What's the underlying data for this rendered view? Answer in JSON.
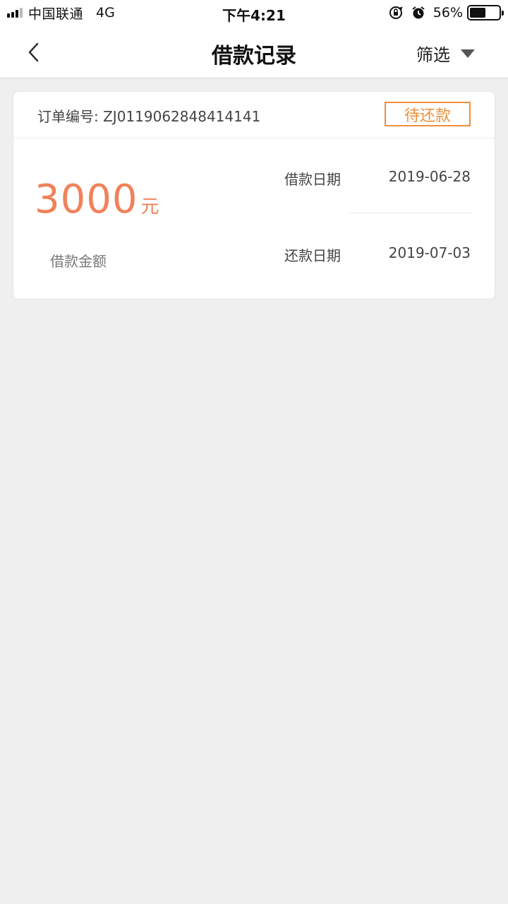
{
  "status_bar": {
    "carrier": "中国联通",
    "network": "4G",
    "time": "下午4:21",
    "battery": "56%",
    "battery_level": 0.56
  },
  "nav": {
    "title": "借款记录",
    "filter_label": "筛选",
    "icons": {
      "back": "chevron-left-icon",
      "filter_caret": "caret-down-icon"
    }
  },
  "record": {
    "order_label": "订单编号:",
    "order_number": "ZJ0119062848414141",
    "status": "待还款",
    "amount": "3000",
    "amount_unit": "元",
    "amount_label": "借款金额",
    "loan_date_label": "借款日期",
    "loan_date": "2019-06-28",
    "repay_date_label": "还款日期",
    "repay_date": "2019-07-03"
  },
  "colors": {
    "accent": "#f08f3a",
    "amount": "#f0825a",
    "background": "#efefef"
  }
}
